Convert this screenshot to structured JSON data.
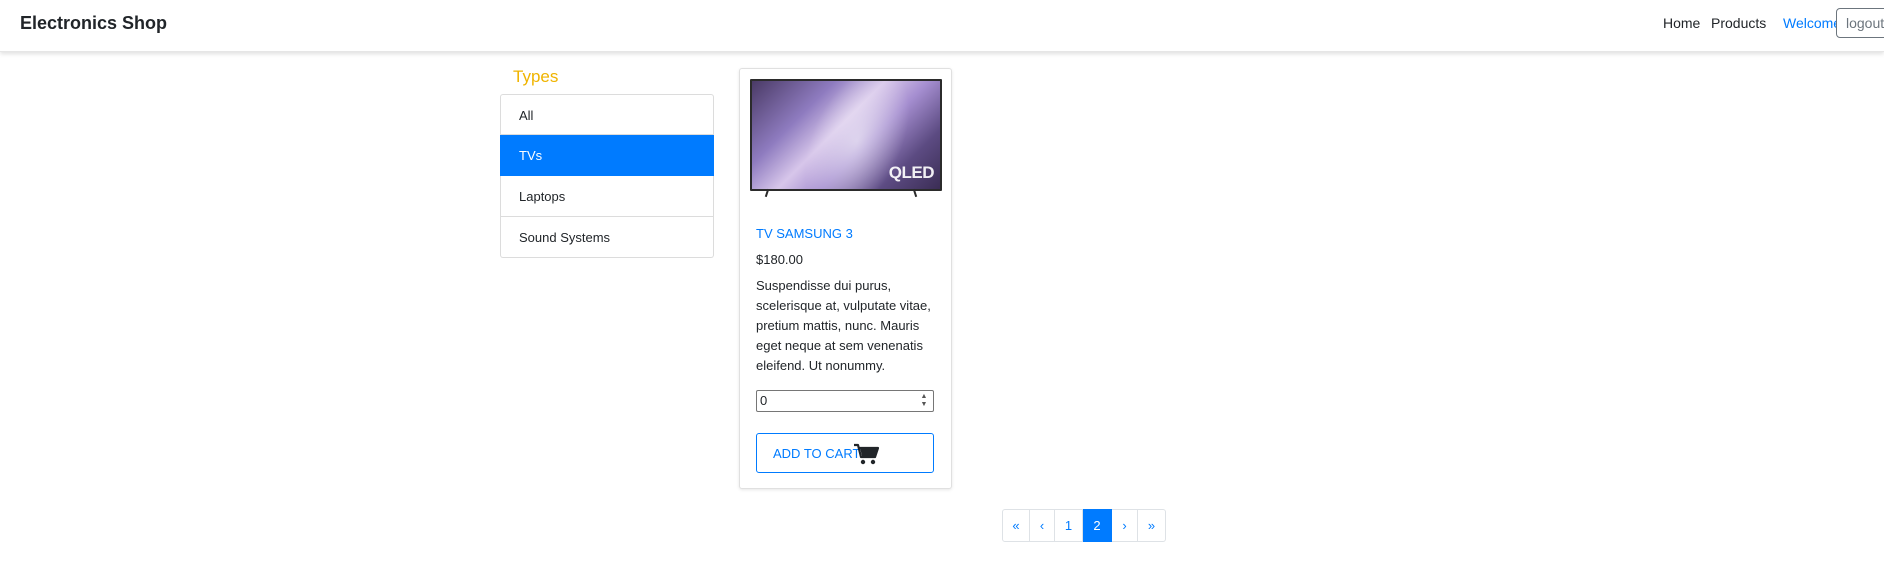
{
  "navbar": {
    "brand": "Electronics Shop",
    "links": [
      {
        "label": "Home"
      },
      {
        "label": "Products"
      }
    ],
    "welcome": "Welcome",
    "logout_label": "logout"
  },
  "sidebar": {
    "heading": "Types",
    "heading_color": "#f0b400",
    "items": [
      {
        "label": "All",
        "active": false
      },
      {
        "label": "TVs",
        "active": true
      },
      {
        "label": "Laptops",
        "active": false
      },
      {
        "label": "Sound Systems",
        "active": false
      }
    ]
  },
  "product": {
    "image_icon": "tv-product-image",
    "image_caption": "QLED",
    "name": "TV SAMSUNG 3",
    "price": "$180.00",
    "description": "Suspendisse dui purus, scelerisque at, vulputate vitae, pretium mattis, nunc. Mauris eget neque at sem venenatis eleifend. Ut nonummy.",
    "quantity": "0",
    "add_to_cart_label": "ADD TO CART",
    "cart_icon": "shopping-cart-icon"
  },
  "pagination": {
    "items": [
      {
        "label": "«"
      },
      {
        "label": "‹"
      },
      {
        "label": "1"
      },
      {
        "label": "2",
        "active": true
      },
      {
        "label": "›"
      },
      {
        "label": "»"
      }
    ]
  },
  "colors": {
    "accent": "#007bff",
    "heading": "#f0b400"
  }
}
